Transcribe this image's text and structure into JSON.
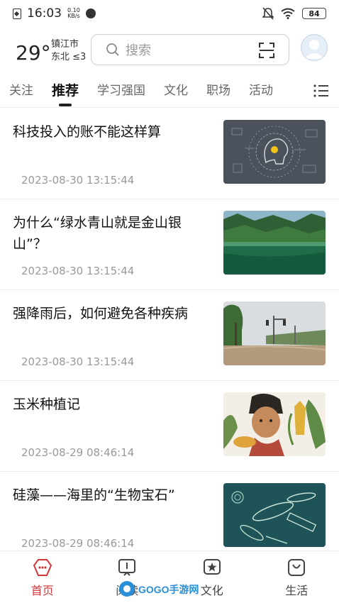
{
  "status_bar": {
    "time": "16:03",
    "net_speed_value": "0.10",
    "net_speed_unit": "KB/s",
    "battery": "84"
  },
  "header": {
    "temperature": "29°",
    "city": "镇江市",
    "wind": "东北 ≤3",
    "search_placeholder": "搜索"
  },
  "tabs": [
    {
      "label": "关注",
      "active": false
    },
    {
      "label": "推荐",
      "active": true
    },
    {
      "label": "学习强国",
      "active": false
    },
    {
      "label": "文化",
      "active": false
    },
    {
      "label": "职场",
      "active": false
    },
    {
      "label": "活动",
      "active": false
    }
  ],
  "articles": [
    {
      "title": "科技投入的账不能这样算",
      "time": "2023-08-30 13:15:44"
    },
    {
      "title": "为什么“绿水青山就是金山银山”？",
      "time": "2023-08-30 13:15:44"
    },
    {
      "title": "强降雨后，如何避免各种疾病",
      "time": "2023-08-30 13:15:44"
    },
    {
      "title": "玉米种植记",
      "time": "2023-08-29 08:46:14"
    },
    {
      "title": "硅藻——海里的“生物宝石”",
      "time": "2023-08-29 08:46:14"
    }
  ],
  "bottom_nav": [
    {
      "label": "首页",
      "icon": "home-icon",
      "active": true
    },
    {
      "label": "阅读",
      "icon": "book-icon",
      "active": false
    },
    {
      "label": "文化",
      "icon": "star-icon",
      "active": false
    },
    {
      "label": "生活",
      "icon": "bag-icon",
      "active": false
    }
  ],
  "watermark": "GOGO手游网",
  "colors": {
    "accent": "#d2383a",
    "text_primary": "#111111",
    "text_secondary": "#999999"
  }
}
